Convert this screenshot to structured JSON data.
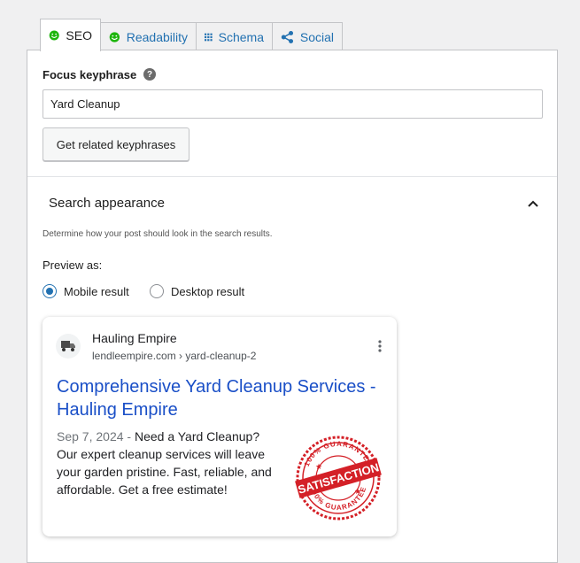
{
  "tabs": [
    {
      "label": "SEO",
      "icon": "smiley-icon",
      "active": true
    },
    {
      "label": "Readability",
      "icon": "smiley-icon",
      "active": false
    },
    {
      "label": "Schema",
      "icon": "grid-icon",
      "active": false
    },
    {
      "label": "Social",
      "icon": "share-icon",
      "active": false
    }
  ],
  "colors": {
    "accent": "#2271b1",
    "good": "#1db50c",
    "link": "#1a4fc7",
    "stamp": "#d42027"
  },
  "focus": {
    "label": "Focus keyphrase",
    "value": "Yard Cleanup",
    "related_button": "Get related keyphrases"
  },
  "search_appearance": {
    "title": "Search appearance",
    "description": "Determine how your post should look in the search results.",
    "preview_label": "Preview as:",
    "options": [
      {
        "label": "Mobile result",
        "checked": true
      },
      {
        "label": "Desktop result",
        "checked": false
      }
    ]
  },
  "preview": {
    "site_name": "Hauling Empire",
    "url": "lendleempire.com › yard-cleanup-2",
    "title": "Comprehensive Yard Cleanup Services - Hauling Empire",
    "date": "Sep 7, 2024",
    "separator": " - ",
    "description": "Need a Yard Cleanup? Our expert cleanup services will leave your garden pristine. Fast, reliable, and affordable. Get a free estimate!",
    "stamp_main": "SATISFACTION",
    "stamp_top": "100% GUARANTEE",
    "stamp_bottom": "100% GUARANTEE"
  }
}
